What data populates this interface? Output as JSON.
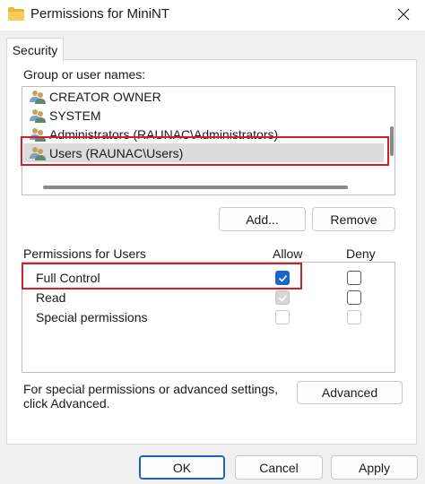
{
  "window": {
    "title": "Permissions for MiniNT",
    "title_icon": "folder-icon",
    "close_icon": "close-icon"
  },
  "tabs": [
    {
      "label": "Security",
      "selected": true
    }
  ],
  "group_section": {
    "label": "Group or user names:",
    "users": [
      {
        "label": "CREATOR OWNER",
        "icon": "users-icon",
        "selected": false
      },
      {
        "label": "SYSTEM",
        "icon": "users-icon",
        "selected": false
      },
      {
        "label": "Administrators (RAUNAC\\Administrators)",
        "icon": "users-icon",
        "selected": false
      },
      {
        "label": "Users (RAUNAC\\Users)",
        "icon": "users-icon",
        "selected": true
      }
    ],
    "add_label": "Add...",
    "remove_label": "Remove"
  },
  "permissions": {
    "header_label": "Permissions for Users",
    "allow_label": "Allow",
    "deny_label": "Deny",
    "rows": [
      {
        "label": "Full Control",
        "allow": "checked",
        "deny": "unchecked"
      },
      {
        "label": "Read",
        "allow": "checked-disabled",
        "deny": "unchecked"
      },
      {
        "label": "Special permissions",
        "allow": "disabled",
        "deny": "disabled"
      }
    ]
  },
  "advanced": {
    "text_line1": "For special permissions or advanced settings,",
    "text_line2": "click Advanced.",
    "button_label": "Advanced"
  },
  "dialog_buttons": {
    "ok_label": "OK",
    "cancel_label": "Cancel",
    "apply_label": "Apply"
  },
  "colors": {
    "highlight_box": "#d0202a",
    "checkbox_accent": "#1766c8",
    "selection_bg": "#dcdcdc"
  }
}
